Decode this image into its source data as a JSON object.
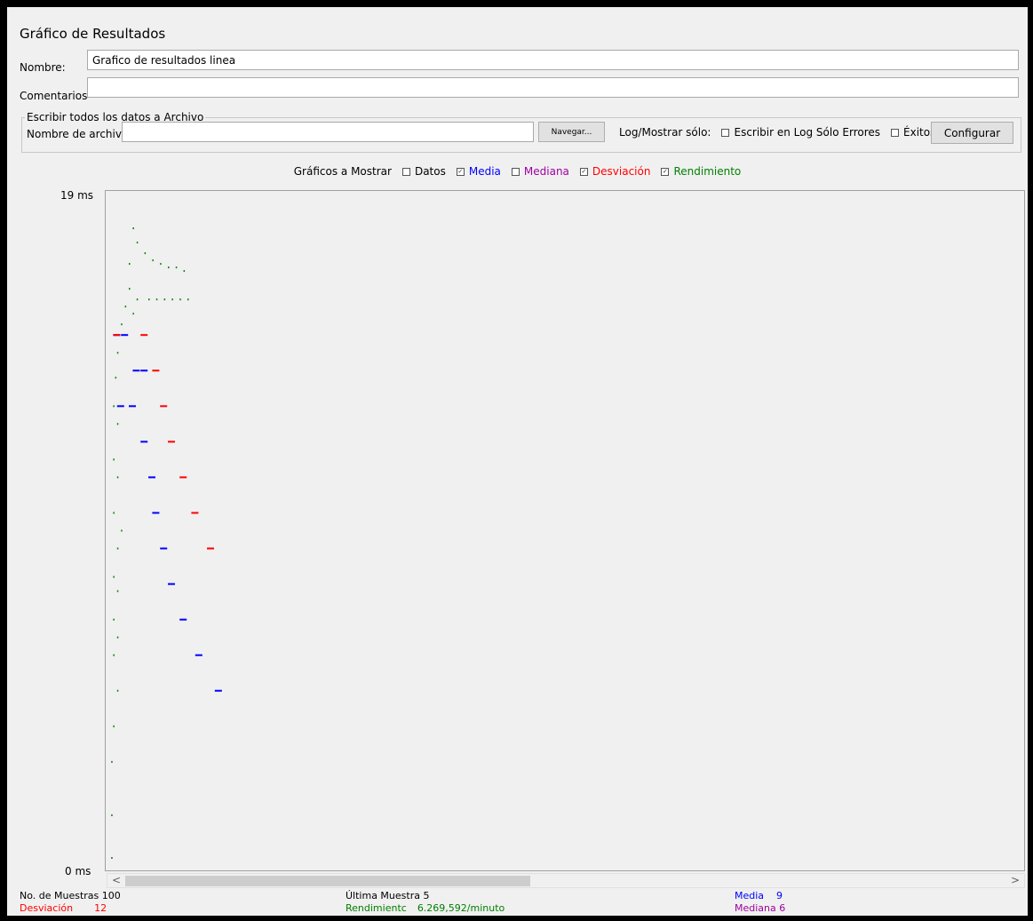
{
  "panel_title": "Gráfico de Resultados",
  "name": {
    "label": "Nombre:",
    "value": "Grafico de resultados linea"
  },
  "comments": {
    "label": "Comentarios",
    "value": ""
  },
  "file_group": {
    "legend": "Escribir todos los datos a Archivo",
    "filename_label": "Nombre de archivc",
    "filename_value": "",
    "browse_label": "Navegar...",
    "log_label": "Log/Mostrar sólo:",
    "errors_label": "Escribir en Log Sólo Errores",
    "success_label": "Éxitos",
    "configure_label": "Configurar"
  },
  "graphs_to_show": {
    "label": "Gráficos a Mostrar",
    "options": [
      {
        "label": "Datos",
        "checked": false,
        "color": "#000000"
      },
      {
        "label": "Media",
        "checked": true,
        "color": "#0000ff"
      },
      {
        "label": "Mediana",
        "checked": false,
        "color": "#a000a0"
      },
      {
        "label": "Desviación",
        "checked": true,
        "color": "#ff0000"
      },
      {
        "label": "Rendimiento",
        "checked": true,
        "color": "#008000"
      }
    ]
  },
  "y_axis": {
    "top_label": "19 ms",
    "bottom_label": "0 ms",
    "max": 19,
    "min": 0
  },
  "scrollbar": {
    "left_arrow": "<",
    "right_arrow": ">"
  },
  "chart_data": {
    "type": "scatter",
    "ylim": [
      0,
      19
    ],
    "series": [
      {
        "name": "Media",
        "color": "#0000ff",
        "points": [
          [
            1,
            15
          ],
          [
            3,
            15
          ],
          [
            6,
            14
          ],
          [
            8,
            14
          ],
          [
            2,
            13
          ],
          [
            5,
            13
          ],
          [
            8,
            12
          ],
          [
            10,
            11
          ],
          [
            11,
            10
          ],
          [
            13,
            9
          ],
          [
            15,
            8
          ],
          [
            18,
            7
          ],
          [
            22,
            6
          ],
          [
            27,
            5
          ]
        ]
      },
      {
        "name": "Desviación",
        "color": "#ff0000",
        "points": [
          [
            1,
            15
          ],
          [
            8,
            15
          ],
          [
            11,
            14
          ],
          [
            13,
            13
          ],
          [
            15,
            12
          ],
          [
            18,
            11
          ],
          [
            21,
            10
          ],
          [
            25,
            9
          ]
        ]
      },
      {
        "name": "Rendimiento",
        "color": "#008000",
        "points": [
          [
            6,
            18
          ],
          [
            7,
            17.6
          ],
          [
            5,
            17
          ],
          [
            9,
            17.3
          ],
          [
            11,
            17.1
          ],
          [
            13,
            17
          ],
          [
            15,
            16.9
          ],
          [
            17,
            16.9
          ],
          [
            19,
            16.8
          ],
          [
            5,
            16.3
          ],
          [
            7,
            16
          ],
          [
            10,
            16
          ],
          [
            12,
            16
          ],
          [
            14,
            16
          ],
          [
            16,
            16
          ],
          [
            18,
            16
          ],
          [
            20,
            16
          ],
          [
            4,
            15.8
          ],
          [
            6,
            15.6
          ],
          [
            3,
            15.3
          ],
          [
            2,
            14.5
          ],
          [
            1.5,
            13.8
          ],
          [
            1,
            13
          ],
          [
            2,
            12.5
          ],
          [
            1,
            11.5
          ],
          [
            2,
            11
          ],
          [
            1,
            10
          ],
          [
            3,
            9.5
          ],
          [
            2,
            9
          ],
          [
            1,
            8.2
          ],
          [
            2,
            7.8
          ],
          [
            1,
            7
          ],
          [
            2,
            6.5
          ],
          [
            1,
            6
          ],
          [
            2,
            5
          ],
          [
            1,
            4
          ],
          [
            0.5,
            3
          ],
          [
            0.5,
            1.5
          ],
          [
            0.5,
            0.3
          ]
        ]
      }
    ]
  },
  "stats": {
    "samples_label": "No. de Muestras",
    "samples_value": "100",
    "last_label": "Última Muestra",
    "last_value": "5",
    "mean_label": "Media",
    "mean_value": "9",
    "dev_label": "Desviación",
    "dev_value": "12",
    "throughput_label": "Rendimientc",
    "throughput_value": "6.269,592/minuto",
    "median_label": "Mediana",
    "median_value": "6"
  }
}
